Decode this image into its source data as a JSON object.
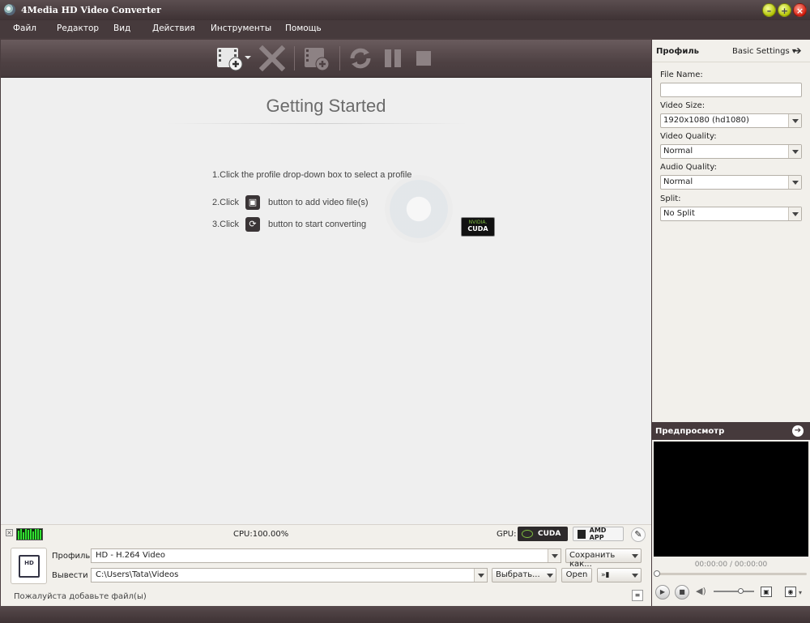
{
  "window": {
    "title": "4Media HD Video Converter"
  },
  "menu": {
    "items": [
      "Файл",
      "Редактор",
      "Вид",
      "Действия",
      "Инструменты",
      "Помощь"
    ]
  },
  "main": {
    "heading": "Getting Started",
    "step1": "1.Click the profile drop-down box to select a profile",
    "step2_prefix": "2.Click",
    "step2_suffix": "button to add video file(s)",
    "step3_prefix": "3.Click",
    "step3_suffix": "button to start converting",
    "cuda_badge_top": "NVIDIA.",
    "cuda_badge_bottom": "CUDA"
  },
  "status": {
    "cpu": "CPU:100.00%",
    "gpu_label": "GPU:",
    "cuda_button": "CUDA",
    "amd_button": "AMD APP"
  },
  "bottom": {
    "profile_label": "Профиль:",
    "profile_value": "HD - H.264 Video",
    "save_as": "Сохранить как...",
    "output_label": "Вывести в:",
    "output_path": "C:\\Users\\Tata\\Videos",
    "browse": "Выбрать...",
    "open": "Open",
    "hint": "Пожалуйста добавьте файл(ы)",
    "profile_icon_text": "HD"
  },
  "right_panel": {
    "title": "Профиль",
    "basic_settings": "Basic Settings",
    "file_name_label": "File Name:",
    "file_name_value": "",
    "video_size_label": "Video Size:",
    "video_size_value": "1920x1080 (hd1080)",
    "video_quality_label": "Video Quality:",
    "video_quality_value": "Normal",
    "audio_quality_label": "Audio Quality:",
    "audio_quality_value": "Normal",
    "split_label": "Split:",
    "split_value": "No Split"
  },
  "preview": {
    "title": "Предпросмотр",
    "time": "00:00:00 / 00:00:00"
  }
}
